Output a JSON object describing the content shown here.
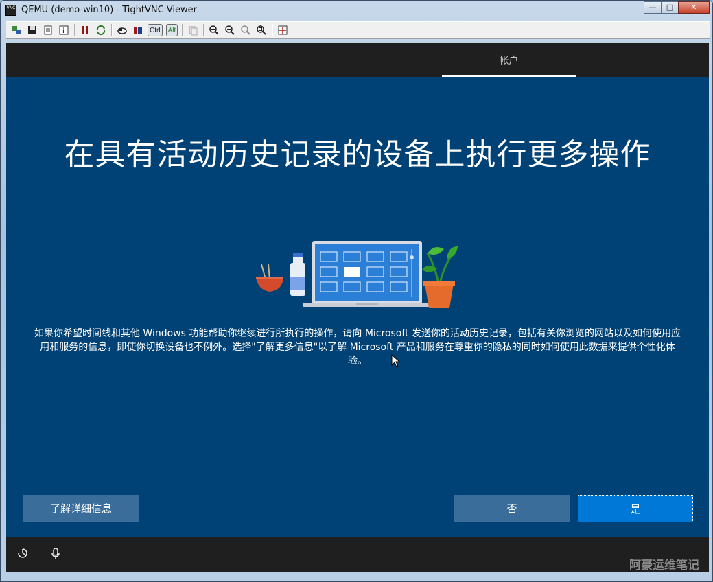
{
  "window": {
    "title": "QEMU (demo-win10) - TightVNC Viewer",
    "app_icon_text": "VNC",
    "controls": {
      "minimize": "—",
      "maximize": "□",
      "close": "✕"
    }
  },
  "toolbar": {
    "ctrl_label": "Ctrl",
    "alt_label": "Alt",
    "icons": [
      "new-connection-icon",
      "save-icon",
      "options-icon",
      "info-icon",
      "pause-icon",
      "refresh-icon",
      "ctrl-alt-del-icon",
      "ctrl-esc-icon",
      "ctrl-key-icon",
      "alt-key-icon",
      "clipboard-icon",
      "zoom-in-icon",
      "zoom-out-icon",
      "zoom-100-icon",
      "zoom-fit-icon",
      "fullscreen-icon"
    ]
  },
  "oobe": {
    "tab_label": "帐户",
    "headline": "在具有活动历史记录的设备上执行更多操作",
    "description": "如果你希望时间线和其他 Windows 功能帮助你继续进行所执行的操作，请向 Microsoft 发送你的活动历史记录，包括有关你浏览的网站以及如何使用应用和服务的信息，即使你切换设备也不例外。选择\"了解更多信息\"以了解 Microsoft 产品和服务在尊重你的隐私的同时如何使用此数据来提供个性化体验。",
    "learn_more_label": "了解详细信息",
    "no_label": "否",
    "yes_label": "是",
    "accent_color": "#0078d7",
    "background_color": "#004275"
  },
  "bottombar": {
    "icons": [
      "ease-of-access-icon",
      "microphone-icon"
    ]
  },
  "watermark": "阿豪运维笔记"
}
